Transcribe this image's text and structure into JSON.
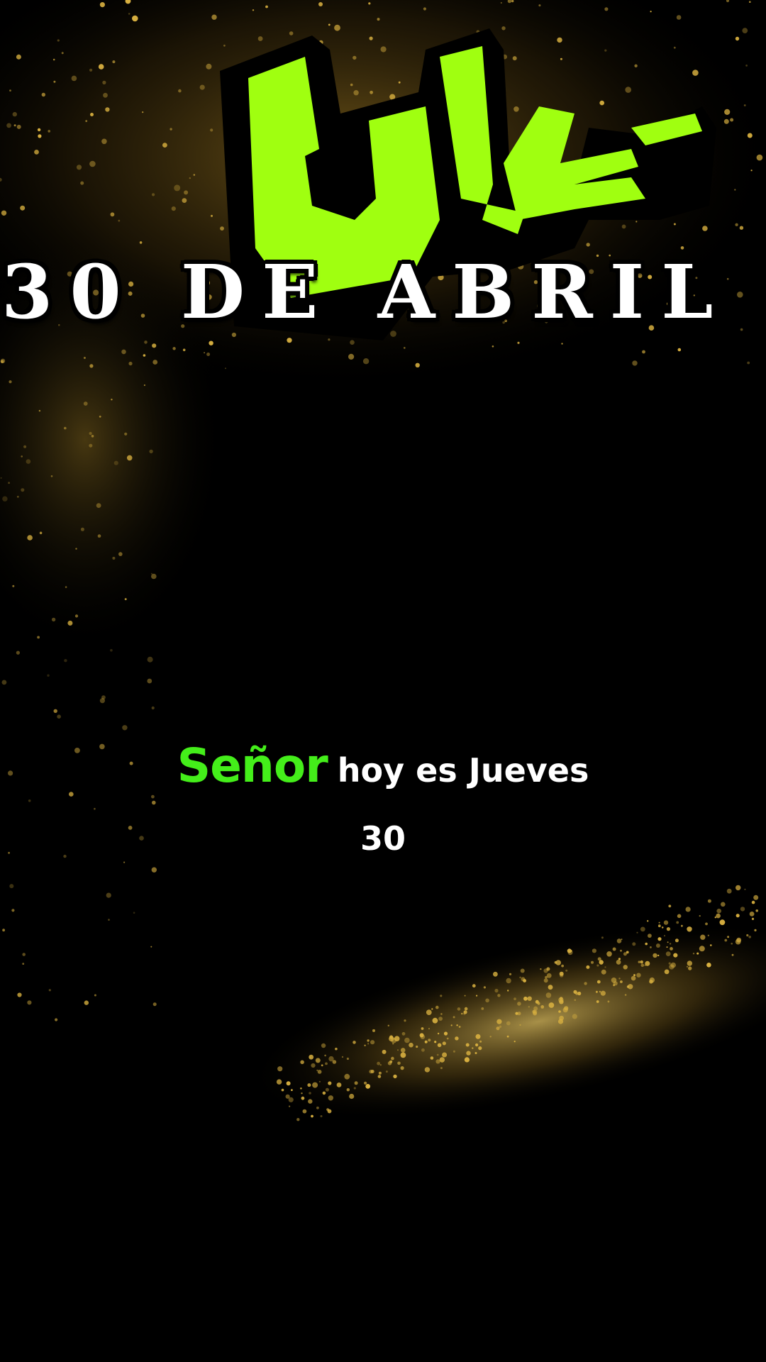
{
  "title": {
    "date_text": "30 DE ABRIL"
  },
  "logo": {
    "icon_name": "green-glyph-logo",
    "fill_color": "#a0ff10",
    "outline_color": "#000000"
  },
  "caption": {
    "highlight_word": "Señor",
    "rest_line1": "hoy es Jueves",
    "line2": "30",
    "highlight_color": "#44ee1a",
    "text_color": "#ffffff"
  },
  "background": {
    "base_color": "#000000",
    "sparkle_color": "#d8b040"
  }
}
